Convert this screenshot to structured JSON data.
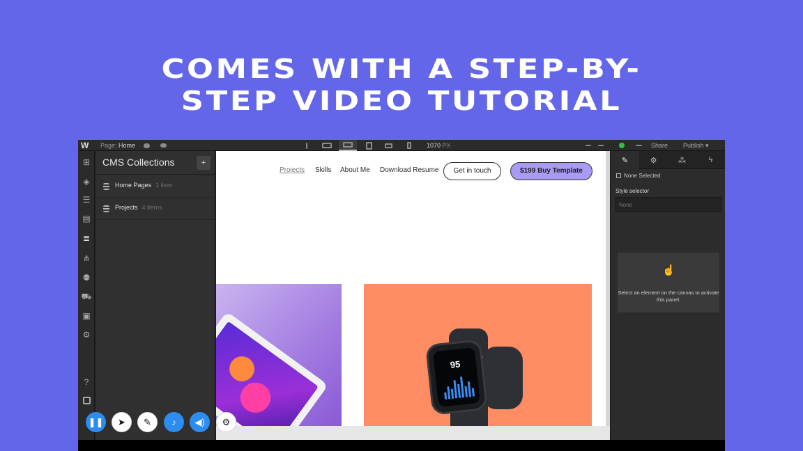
{
  "headline": {
    "line1": "COMES WITH A STEP-BY-",
    "line2": "STEP VIDEO TUTORIAL"
  },
  "topbar": {
    "logo": "W",
    "page_prefix": "Page:",
    "page_name": "Home",
    "width_value": "1070",
    "width_unit": "PX",
    "share_label": "Share",
    "publish_label": "Publish"
  },
  "cms": {
    "title": "CMS Collections",
    "collections": [
      {
        "name": "Home Pages",
        "count": "1 item"
      },
      {
        "name": "Projects",
        "count": "4 items"
      }
    ]
  },
  "site_nav": {
    "links": [
      "Projects",
      "Skills",
      "About Me",
      "Download Resume"
    ],
    "contact_button": "Get in touch",
    "buy_button": "$199 Buy Template"
  },
  "watch": {
    "reading": "95"
  },
  "right_panel": {
    "none_selected": "None Selected",
    "style_selector_label": "Style selector",
    "style_selector_placeholder": "None",
    "empty_message": "Select an element on the canvas to activate this panel."
  },
  "colors": {
    "background": "#6366e8",
    "buy_button": "#a99af3",
    "orange_card": "#ff8c62",
    "status_green": "#2fbf4a",
    "recorder_blue": "#2d8cf0"
  },
  "recorder_toolbar": {
    "icons": [
      "pause-icon",
      "pointer-icon",
      "pen-icon",
      "microphone-icon",
      "speaker-icon",
      "settings-icon"
    ]
  }
}
